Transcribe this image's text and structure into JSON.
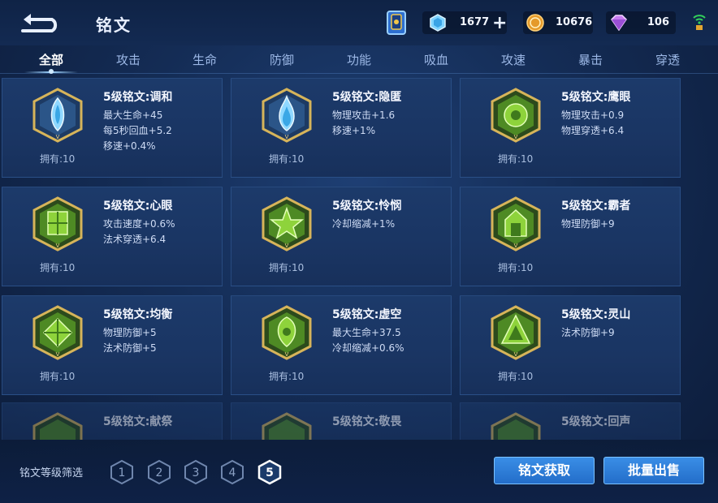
{
  "header": {
    "title": "铭文",
    "currencies": {
      "gem": "1677",
      "coin": "10676",
      "crystal": "106"
    }
  },
  "tabs": [
    "全部",
    "攻击",
    "生命",
    "防御",
    "功能",
    "吸血",
    "攻速",
    "暴击",
    "穿透"
  ],
  "runes": [
    {
      "name": "5级铭文:调和",
      "stats": [
        "最大生命+45",
        "每5秒回血+5.2",
        "移速+0.4%"
      ],
      "owned": "拥有:10",
      "color": "blue"
    },
    {
      "name": "5级铭文:隐匿",
      "stats": [
        "物理攻击+1.6",
        "移速+1%"
      ],
      "owned": "拥有:10",
      "color": "blue"
    },
    {
      "name": "5级铭文:鹰眼",
      "stats": [
        "物理攻击+0.9",
        "物理穿透+6.4"
      ],
      "owned": "拥有:10",
      "color": "green"
    },
    {
      "name": "5级铭文:心眼",
      "stats": [
        "攻击速度+0.6%",
        "法术穿透+6.4"
      ],
      "owned": "拥有:10",
      "color": "green"
    },
    {
      "name": "5级铭文:怜悯",
      "stats": [
        "冷却缩减+1%"
      ],
      "owned": "拥有:10",
      "color": "green"
    },
    {
      "name": "5级铭文:霸者",
      "stats": [
        "物理防御+9"
      ],
      "owned": "拥有:10",
      "color": "green"
    },
    {
      "name": "5级铭文:均衡",
      "stats": [
        "物理防御+5",
        "法术防御+5"
      ],
      "owned": "拥有:10",
      "color": "green"
    },
    {
      "name": "5级铭文:虚空",
      "stats": [
        "最大生命+37.5",
        "冷却缩减+0.6%"
      ],
      "owned": "拥有:10",
      "color": "green"
    },
    {
      "name": "5级铭文:灵山",
      "stats": [
        "法术防御+9"
      ],
      "owned": "拥有:10",
      "color": "green"
    },
    {
      "name": "5级铭文:献祭",
      "stats": [],
      "owned": "",
      "color": "green"
    },
    {
      "name": "5级铭文:敬畏",
      "stats": [],
      "owned": "",
      "color": "green"
    },
    {
      "name": "5级铭文:回声",
      "stats": [],
      "owned": "",
      "color": "green"
    }
  ],
  "footer": {
    "filter_label": "铭文等级筛选",
    "levels": [
      "1",
      "2",
      "3",
      "4",
      "5"
    ],
    "selected_level": "5",
    "get_button": "铭文获取",
    "sell_button": "批量出售"
  },
  "colors": {
    "accent": "#9fd4ff",
    "button": "#2a7ad6",
    "gold": "#c9a24a"
  }
}
